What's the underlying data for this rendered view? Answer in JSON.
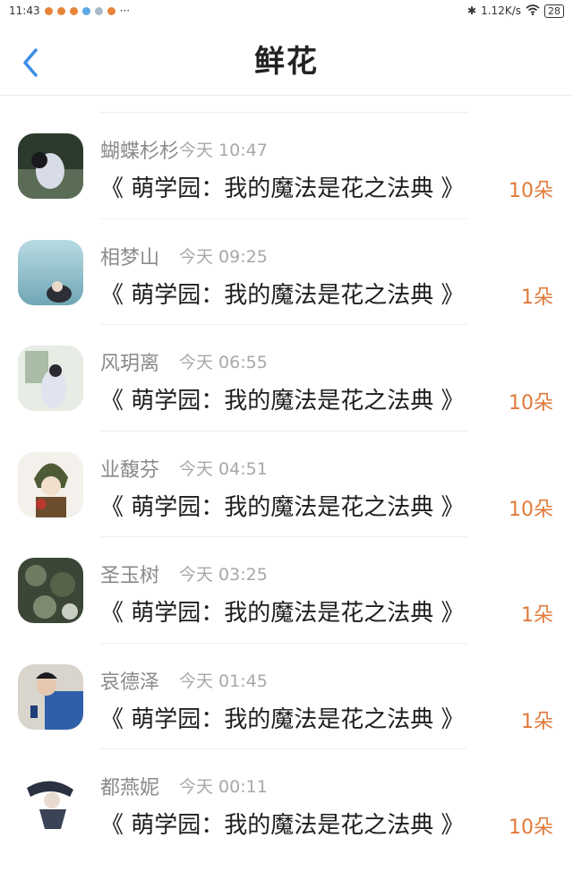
{
  "statusbar": {
    "time": "11:43",
    "more": "···",
    "speed": "1.12K/s",
    "battery": "28"
  },
  "header": {
    "title": "鲜花"
  },
  "colors": {
    "accent": "#3a8ee6",
    "amount": "#e07a3a"
  },
  "items": [
    {
      "name": "蝴蝶杉杉",
      "time": "今天 10:47",
      "book": "《 萌学园：我的魔法是花之法典 》",
      "amount": "10朵"
    },
    {
      "name": "相梦山",
      "time": "今天 09:25",
      "book": "《 萌学园：我的魔法是花之法典 》",
      "amount": "1朵"
    },
    {
      "name": "风玥离",
      "time": "今天 06:55",
      "book": "《 萌学园：我的魔法是花之法典 》",
      "amount": "10朵"
    },
    {
      "name": "业馥芬",
      "time": "今天 04:51",
      "book": "《 萌学园：我的魔法是花之法典 》",
      "amount": "10朵"
    },
    {
      "name": "圣玉树",
      "time": "今天 03:25",
      "book": "《 萌学园：我的魔法是花之法典 》",
      "amount": "1朵"
    },
    {
      "name": "哀德泽",
      "time": "今天 01:45",
      "book": "《 萌学园：我的魔法是花之法典 》",
      "amount": "1朵"
    },
    {
      "name": "都燕妮",
      "time": "今天 00:11",
      "book": "《 萌学园：我的魔法是花之法典 》",
      "amount": "10朵"
    }
  ]
}
